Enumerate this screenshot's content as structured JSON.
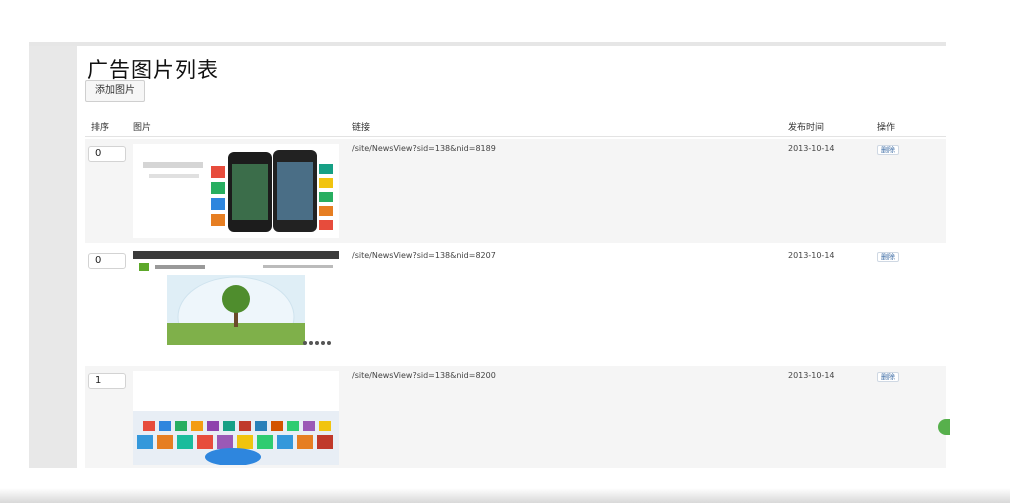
{
  "page": {
    "title": "广告图片列表",
    "add_button": "添加图片"
  },
  "table": {
    "headers": {
      "sort": "排序",
      "image": "图片",
      "link": "链接",
      "time": "发布时间",
      "action": "操作"
    },
    "rows": [
      {
        "sort": "0",
        "link": "/site/NewsView?sid=138&nid=8189",
        "date": "2013-10-14",
        "action": "删除",
        "image_icon": "phone-app-banner"
      },
      {
        "sort": "0",
        "link": "/site/NewsView?sid=138&nid=8207",
        "date": "2013-10-14",
        "action": "删除",
        "image_icon": "tree-landscape-banner"
      },
      {
        "sort": "1",
        "link": "/site/NewsView?sid=138&nid=8200",
        "date": "2013-10-14",
        "action": "删除",
        "image_icon": "app-icons-grid-banner"
      }
    ]
  },
  "colors": {
    "rail": "#e8e8e8",
    "alt_row": "#f5f5f5",
    "action_text": "#3a6aa3",
    "scroll_accent": "#57b04c"
  }
}
